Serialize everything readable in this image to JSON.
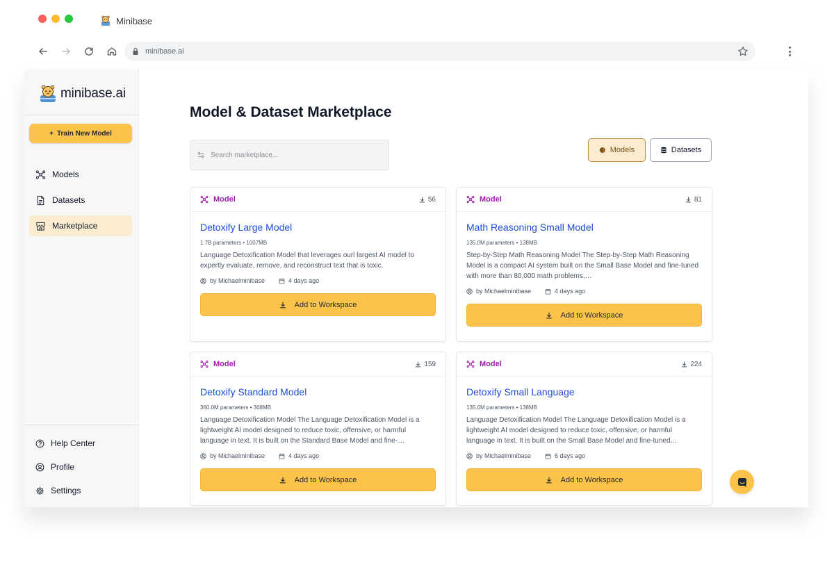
{
  "browser": {
    "tab_title": "Minibase",
    "url": "minibase.ai"
  },
  "sidebar": {
    "brand": "minibase.ai",
    "train_button": "Train New Model",
    "nav": [
      {
        "label": "Models",
        "icon": "models-icon"
      },
      {
        "label": "Datasets",
        "icon": "document-icon"
      },
      {
        "label": "Marketplace",
        "icon": "store-icon",
        "active": true
      }
    ],
    "bottom": [
      {
        "label": "Help Center",
        "icon": "help-icon"
      },
      {
        "label": "Profile",
        "icon": "profile-icon"
      },
      {
        "label": "Settings",
        "icon": "gear-icon"
      }
    ]
  },
  "main": {
    "title": "Model & Dataset Marketplace",
    "search_placeholder": "Search marketplace...",
    "toggles": {
      "models": "Models",
      "datasets": "Datasets",
      "active": "models"
    },
    "cards": [
      {
        "tag": "Model",
        "downloads": "56",
        "title": "Detoxify Large Model",
        "meta": "1.7B parameters • 1007MB",
        "description": "Language Detoxification Model that leverages ourl largest AI model to expertly evaluate, remove, and reconstruct text that is toxic.",
        "author": "by Michaelminibase",
        "date": "4 days ago",
        "button": "Add to Workspace"
      },
      {
        "tag": "Model",
        "downloads": "81",
        "title": "Math Reasoning Small Model",
        "meta": "135.0M parameters • 138MB",
        "description": "Step-by-Step Math Reasoning Model The Step-by-Step Math Reasoning Model is a compact AI system built on the Small Base Model and fine-tuned with more than 80,000 math problems,…",
        "author": "by Michaelminibase",
        "date": "4 days ago",
        "button": "Add to Workspace"
      },
      {
        "tag": "Model",
        "downloads": "159",
        "title": "Detoxify Standard Model",
        "meta": "360.0M parameters • 368MB",
        "description": "Language Detoxification Model The Language Detoxification Model is a lightweight AI model designed to reduce toxic, offensive, or harmful language in text. It is built on the Standard Base Model and fine-…",
        "author": "by Michaelminibase",
        "date": "4 days ago",
        "button": "Add to Workspace"
      },
      {
        "tag": "Model",
        "downloads": "224",
        "title": "Detoxify Small Language",
        "meta": "135.0M parameters • 138MB",
        "description": "Language Detoxification Model The Language Detoxification Model is a lightweight AI model designed to reduce toxic, offensive, or harmful language in text. It is built on the Small Base Model and fine-tuned…",
        "author": "by Michaelminibase",
        "date": "6 days ago",
        "button": "Add to Workspace"
      }
    ]
  },
  "colors": {
    "accent": "#fbc34a",
    "active_nav": "#fbeccf",
    "tag": "#a21caf",
    "link": "#1d4ed8"
  }
}
